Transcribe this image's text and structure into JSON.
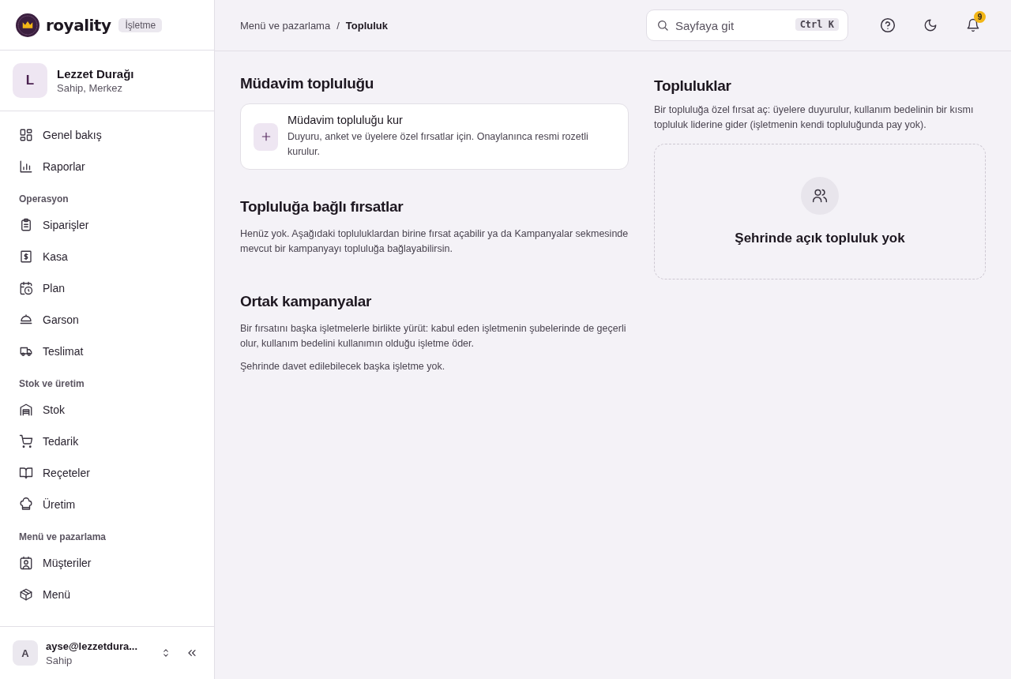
{
  "brand": {
    "name": "royality",
    "badge": "İşletme"
  },
  "business": {
    "initial": "L",
    "name": "Lezzet Durağı",
    "role": "Sahip, Merkez"
  },
  "nav": [
    {
      "items": [
        "Genel bakış",
        "Raporlar"
      ]
    },
    {
      "heading": "Operasyon",
      "items": [
        "Siparişler",
        "Kasa",
        "Plan",
        "Garson",
        "Teslimat"
      ]
    },
    {
      "heading": "Stok ve üretim",
      "items": [
        "Stok",
        "Tedarik",
        "Reçeteler",
        "Üretim"
      ]
    },
    {
      "heading": "Menü ve pazarlama",
      "items": [
        "Müşteriler",
        "Menü"
      ]
    }
  ],
  "user": {
    "initial": "A",
    "email": "ayse@lezzetdura...",
    "role": "Sahip"
  },
  "breadcrumb": [
    "Menü ve pazarlama",
    "/",
    "Topluluk"
  ],
  "search": {
    "placeholder": "Sayfaya git",
    "shortcut": "Ctrl K"
  },
  "notifications": {
    "count": "9"
  },
  "left": {
    "title": "Müdavim topluluğu",
    "create_card": {
      "title": "Müdavim topluluğu kur",
      "text": "Duyuru, anket ve üyelere özel fırsatlar için. Onaylanınca resmi rozetli kurulur."
    },
    "sections": [
      {
        "title": "Topluluğa bağlı fırsatlar",
        "paragraphs": [
          "Henüz yok. Aşağıdaki topluluklardan birine fırsat açabilir ya da Kampanyalar sekmesinde mevcut bir kampanyayı topluluğa bağlayabilirsin."
        ]
      },
      {
        "title": "Ortak kampanyalar",
        "paragraphs": [
          "Bir fırsatını başka işletmelerle birlikte yürüt: kabul eden işletmenin şubelerinde de geçerli olur, kullanım bedelini kullanımın olduğu işletme öder.",
          "Şehrinde davet edilebilecek başka işletme yok."
        ]
      }
    ]
  },
  "right": {
    "title": "Topluluklar",
    "text": "Bir topluluğa özel fırsat aç: üyelere duyurulur, kullanım bedelinin bir kısmı topluluk liderine gider (işletmenin kendi topluluğunda pay yok).",
    "empty": "Şehrinde açık topluluk yok"
  }
}
